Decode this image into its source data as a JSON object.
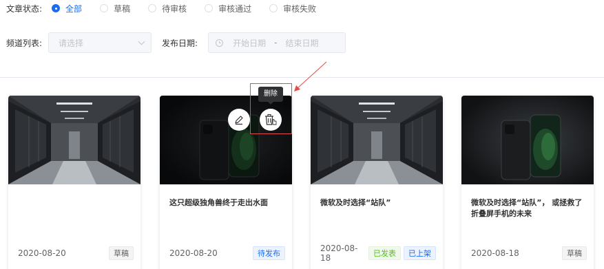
{
  "filters": {
    "status_label": "文章状态:",
    "status_options": [
      "全部",
      "草稿",
      "待审核",
      "审核通过",
      "审核失败"
    ],
    "status_selected": "全部",
    "channel_label": "频道列表:",
    "channel_placeholder": "请选择",
    "date_label": "发布日期:",
    "date_start_placeholder": "开始日期",
    "date_separator": "-",
    "date_end_placeholder": "结束日期"
  },
  "tooltip": {
    "delete": "删除"
  },
  "cards": [
    {
      "image": "server-room",
      "title": "",
      "date": "2020-08-20",
      "tags": [
        "草稿"
      ]
    },
    {
      "image": "smartphone",
      "title": "这只超级独角兽终于走出水面",
      "date": "2020-08-20",
      "tags": [
        "待发布"
      ]
    },
    {
      "image": "server-room",
      "title": "微软及时选择“站队”",
      "date": "2020-08-18",
      "tags": [
        "已发表",
        "已上架"
      ]
    },
    {
      "image": "smartphone",
      "title": "微软及时选择“站队”， 或拯救了折叠屏手机的未来",
      "date": "2020-08-18",
      "tags": [
        "草稿"
      ]
    }
  ],
  "colors": {
    "primary": "#1a6cf0",
    "success": "#52c41a",
    "annotation": "#e34b4b"
  }
}
